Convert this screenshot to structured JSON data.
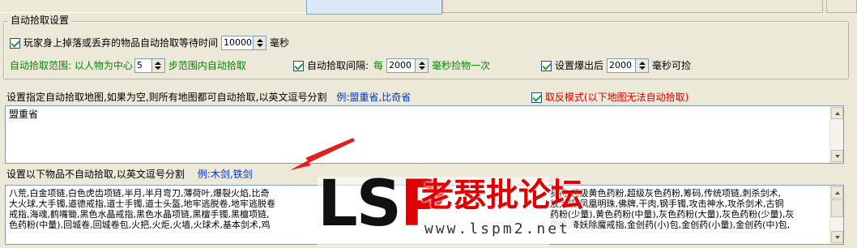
{
  "top_strip": {
    "text": ""
  },
  "group": {
    "title": "自动拾取设置",
    "row1": {
      "checkbox_label": "玩家身上掉落或丢弃的物品自动拾取等待时间",
      "checked": true,
      "value": "10000",
      "unit": "毫秒"
    },
    "row2": {
      "range_label": "自动拾取范围: 以人物为中心",
      "range_value": "5",
      "range_suffix": "步范围内自动拾取",
      "interval_label": "自动拾取间隔:",
      "interval_checked": true,
      "interval_prefix": "每",
      "interval_value": "2000",
      "interval_suffix": "毫秒捡物一次",
      "explode_label": "设置爆出后",
      "explode_checked": true,
      "explode_value": "2000",
      "explode_suffix": "毫秒可捡"
    }
  },
  "maps": {
    "label": "设置指定自动拾取地图,如果为空,则所有地图都可自动拾取,以英文逗号分割",
    "example": "例:盟重省,比奇省",
    "reverse_label": "取反模式(以下地图无法自动拾取)",
    "reverse_checked": true,
    "text": "盟重省"
  },
  "items": {
    "label": "设置以下物品不自动拾取,以英文逗号分割",
    "example": "例:木剑,铁剑",
    "line1_left": "八荒,白金项链,白色虎齿项链,半月,半月弯刀,薄荷叶,爆裂火焰,比奇",
    "line1_right": "身符,超级黄色药粉,超级灰色药粉,筹码,传统项链,刺杀剑术,",
    "line2_left": "大火球,大手镯,道德戒指,道士手镯,道士头盔,地牢逃脱卷,地牢逃脱卷",
    "line2_right": "放大镜,凤凰明珠,佛牌,干肉,钢手镯,攻击神水,攻杀剑术,古铜",
    "line3_left": "戒指,海魂,鹤嘴锄,黑色水晶戒指,黑色水晶项链,黑檀手镯,黑檀项链,",
    "line3_right": "药粉(少量),黄色药粉(中量),灰色药粉(大量),灰色药粉(少量),灰",
    "line4_left": "色药粉(中量),回城卷,回城卷包,火把,火炬,火墙,火球术,基本剑术,鸡",
    "line4_right": "降魔,降妖除魔戒指,金创药(小)包,金创药(小量),金创药(中)包,"
  },
  "watermark": {
    "logo_l": "L",
    "logo_s": "S",
    "logo_p": "P",
    "cn": "老瑟批论坛",
    "url": "www.lspm2.net"
  }
}
